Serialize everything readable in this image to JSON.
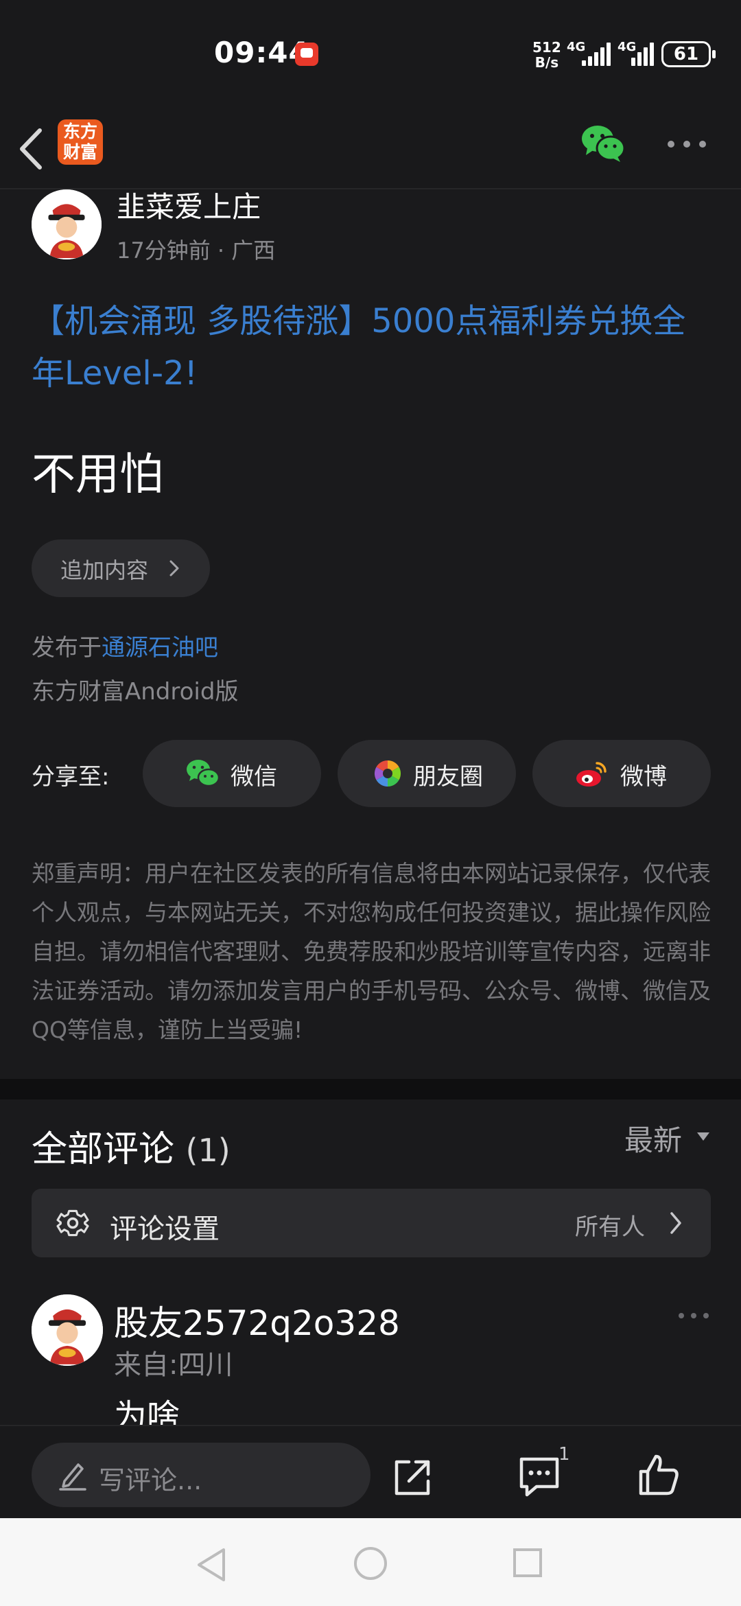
{
  "status_bar": {
    "time": "09:44",
    "net_speed_value": "512",
    "net_speed_unit": "B/s",
    "network_1": "4G",
    "network_2": "4G",
    "battery": "61"
  },
  "nav": {
    "logo_line1": "东方",
    "logo_line2": "财富"
  },
  "author": {
    "name": "韭菜爱上庄",
    "time": "17分钟前",
    "separator": " · ",
    "region": "广西"
  },
  "post": {
    "title": "【机会涌现 多股待涨】5000点福利券兑换全年Level-2!",
    "body": "不用怕",
    "append_label": "追加内容",
    "published_prefix": "发布于",
    "forum": "通源石油吧",
    "client": "东方财富Android版"
  },
  "share": {
    "label": "分享至:",
    "wechat": "微信",
    "moments": "朋友圈",
    "weibo": "微博"
  },
  "disclaimer": "郑重声明：用户在社区发表的所有信息将由本网站记录保存，仅代表个人观点，与本网站无关，不对您构成任何投资建议，据此操作风险自担。请勿相信代客理财、免费荐股和炒股培训等宣传内容，远离非法证券活动。请勿添加发言用户的手机号码、公众号、微博、微信及QQ等信息，谨防上当受骗!",
  "comments": {
    "title": "全部评论",
    "count": "(1)",
    "sort": "最新",
    "settings_label": "评论设置",
    "settings_value": "所有人",
    "items": [
      {
        "user": "股友2572q2o328",
        "location": "来自:四川",
        "text": "为啥"
      }
    ]
  },
  "bottom_bar": {
    "placeholder": "写评论...",
    "comment_count": "1"
  },
  "colors": {
    "background": "#1a1a1c",
    "link_blue": "#3a7fd0",
    "brand_orange": "#ea5a1f",
    "wechat_green": "#3cc350"
  }
}
